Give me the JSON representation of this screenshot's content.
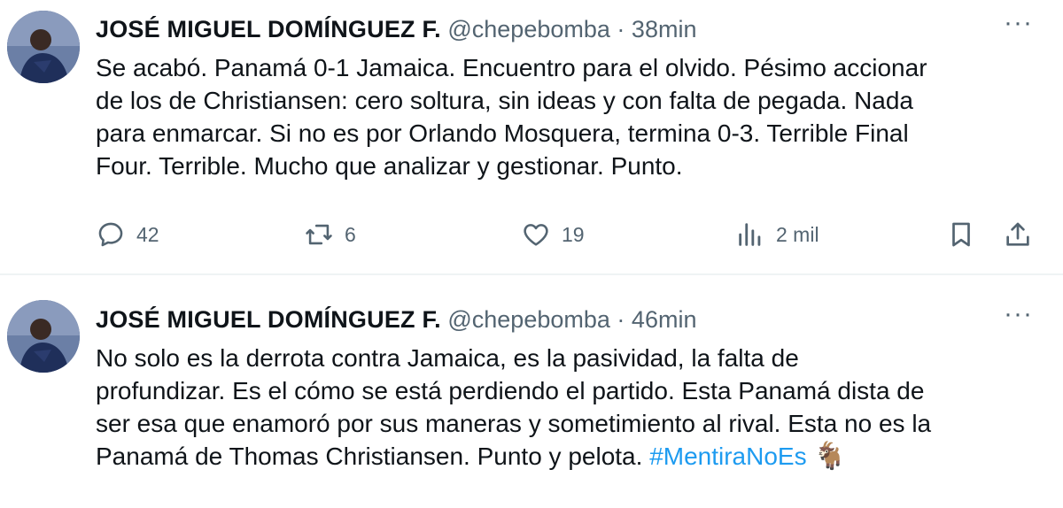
{
  "tweets": [
    {
      "name": "JOSÉ MIGUEL DOMÍNGUEZ F.",
      "handle": "@chepebomba",
      "separator": "·",
      "time": "38min",
      "more": "···",
      "lines": [
        "Se acabó. Panamá 0-1 Jamaica. Encuentro para el olvido. Pésimo accionar",
        "de los de Christiansen: cero soltura, sin ideas y con falta de pegada. Nada",
        "para enmarcar. Si no es por Orlando Mosquera, termina 0-3. Terrible Final",
        "Four. Terrible. Mucho que analizar y gestionar. Punto."
      ],
      "replies": "42",
      "retweets": "6",
      "likes": "19",
      "views": "2 mil",
      "icons": [
        "reply-icon",
        "retweet-icon",
        "like-icon",
        "views-icon",
        "bookmark-icon",
        "share-icon"
      ]
    },
    {
      "name": "JOSÉ MIGUEL DOMÍNGUEZ F.",
      "handle": "@chepebomba",
      "separator": "·",
      "time": "46min",
      "more": "···",
      "lines": [
        "No solo es la derrota contra Jamaica, es la pasividad, la falta de",
        "profundizar. Es el cómo se está perdiendo el partido. Esta Panamá dista de",
        "ser esa que enamoró por sus maneras y sometimiento al rival. Esta no es la"
      ],
      "last_line_text": "Panamá de Thomas Christiansen. Punto y pelota.",
      "hashtag": "#MentiraNoEs",
      "emoji": "🐐"
    }
  ],
  "colors": {
    "text": "#0f1419",
    "secondary": "#536471",
    "link": "#1d9bf0",
    "divider": "#eff3f4"
  }
}
